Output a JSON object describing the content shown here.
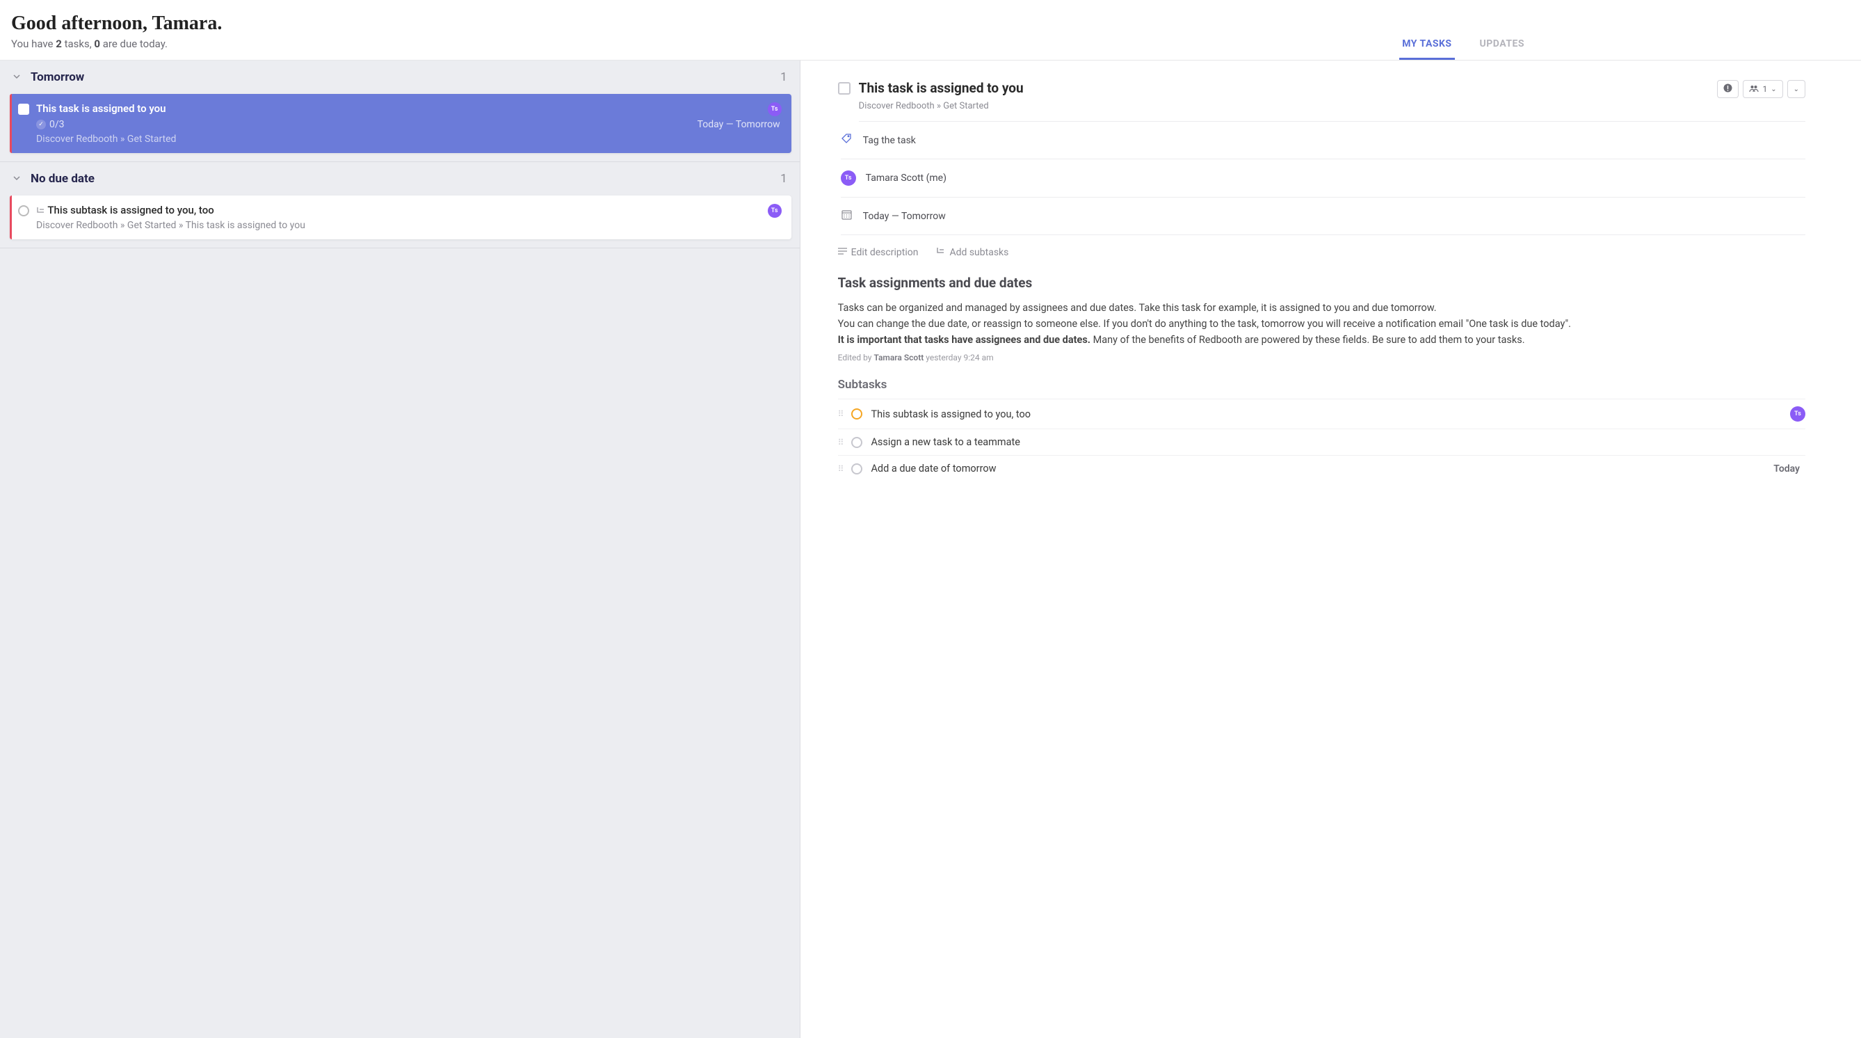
{
  "header": {
    "greeting": "Good afternoon, Tamara.",
    "subgreeting_pre": "You have ",
    "task_count": "2",
    "subgreeting_mid": " tasks, ",
    "due_count": "0",
    "subgreeting_post": " are due today.",
    "tabs": {
      "mytasks": "MY TASKS",
      "updates": "UPDATES"
    }
  },
  "sections": {
    "tomorrow": {
      "title": "Tomorrow",
      "count": "1"
    },
    "nodue": {
      "title": "No due date",
      "count": "1"
    }
  },
  "task1": {
    "title": "This task is assigned to you",
    "subtask_progress": "0/3",
    "date_range": "Today — Tomorrow",
    "breadcrumb": "Discover Redbooth  »  Get Started",
    "avatar": "Ts"
  },
  "task2": {
    "title": "This subtask is assigned to you, too",
    "breadcrumb": "Discover Redbooth  »  Get Started  »  This task is assigned to you",
    "avatar": "Ts"
  },
  "detail": {
    "title": "This task is assigned to you",
    "breadcrumb": "Discover Redbooth  »  Get Started",
    "assignee_count": "1",
    "tag_label": "Tag the task",
    "assignee": {
      "name": "Tamara Scott (me)",
      "avatar": "Ts"
    },
    "date_range": "Today — Tomorrow",
    "edit_desc": "Edit description",
    "add_subtasks": "Add subtasks",
    "desc_title": "Task assignments and due dates",
    "desc_p1": "Tasks can be organized and managed by assignees and due dates. Take this task for example, it is assigned to you and due tomorrow.",
    "desc_p2": "You can change the due date, or reassign to someone else. If you don't do anything to the task, tomorrow you will receive a notification email \"One task is due today\".",
    "desc_p3_bold": "It is important that tasks have assignees and due dates.",
    "desc_p3_rest": " Many of the benefits of Redbooth are powered by these fields. Be sure to add them to your tasks.",
    "edited_pre": "Edited by ",
    "edited_name": "Tamara Scott",
    "edited_time": " yesterday 9:24 am",
    "subtasks_title": "Subtasks",
    "subtasks": [
      {
        "title": "This subtask is assigned to you, too",
        "avatar": "Ts"
      },
      {
        "title": "Assign a new task to a teammate"
      },
      {
        "title": "Add a due date of tomorrow",
        "due": "Today"
      }
    ]
  }
}
